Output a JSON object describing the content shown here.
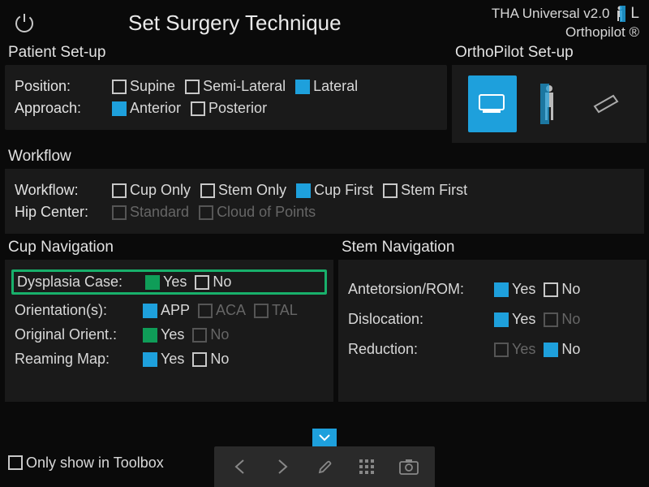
{
  "header": {
    "title": "Set Surgery Technique",
    "version": "THA Universal v2.0",
    "side": "L",
    "brand": "Orthopilot ®"
  },
  "patient_setup": {
    "title": "Patient Set-up",
    "position_label": "Position:",
    "approach_label": "Approach:",
    "positions": [
      {
        "label": "Supine",
        "checked": false
      },
      {
        "label": "Semi-Lateral",
        "checked": false
      },
      {
        "label": "Lateral",
        "checked": true
      }
    ],
    "approaches": [
      {
        "label": "Anterior",
        "checked": true
      },
      {
        "label": "Posterior",
        "checked": false
      }
    ]
  },
  "orthopilot_setup": {
    "title": "OrthoPilot Set-up"
  },
  "workflow": {
    "title": "Workflow",
    "workflow_label": "Workflow:",
    "hipcenter_label": "Hip Center:",
    "options": [
      {
        "label": "Cup Only",
        "checked": false
      },
      {
        "label": "Stem Only",
        "checked": false
      },
      {
        "label": "Cup First",
        "checked": true
      },
      {
        "label": "Stem First",
        "checked": false
      }
    ],
    "hip_center": [
      {
        "label": "Standard",
        "checked": false,
        "disabled": true
      },
      {
        "label": "Cloud of Points",
        "checked": false,
        "disabled": true
      }
    ]
  },
  "cup_nav": {
    "title": "Cup Navigation",
    "dysplasia_label": "Dysplasia Case:",
    "dysplasia": [
      {
        "label": "Yes",
        "checked": true,
        "style": "green"
      },
      {
        "label": "No",
        "checked": false
      }
    ],
    "orient_label": "Orientation(s):",
    "orientations": [
      {
        "label": "APP",
        "checked": true,
        "disabled": false
      },
      {
        "label": "ACA",
        "checked": false,
        "disabled": true
      },
      {
        "label": "TAL",
        "checked": false,
        "disabled": true
      }
    ],
    "orig_label": "Original Orient.:",
    "orig": [
      {
        "label": "Yes",
        "checked": true,
        "style": "green"
      },
      {
        "label": "No",
        "checked": false,
        "disabled": true
      }
    ],
    "ream_label": "Reaming Map:",
    "ream": [
      {
        "label": "Yes",
        "checked": true
      },
      {
        "label": "No",
        "checked": false
      }
    ]
  },
  "stem_nav": {
    "title": "Stem Navigation",
    "ante_label": "Antetorsion/ROM:",
    "ante": [
      {
        "label": "Yes",
        "checked": true
      },
      {
        "label": "No",
        "checked": false
      }
    ],
    "disloc_label": "Dislocation:",
    "disloc": [
      {
        "label": "Yes",
        "checked": true
      },
      {
        "label": "No",
        "checked": false,
        "disabled": true
      }
    ],
    "reduc_label": "Reduction:",
    "reduc": [
      {
        "label": "Yes",
        "checked": false,
        "disabled": true
      },
      {
        "label": "No",
        "checked": true
      }
    ]
  },
  "footer": {
    "only_show_label": "Only show in Toolbox"
  }
}
